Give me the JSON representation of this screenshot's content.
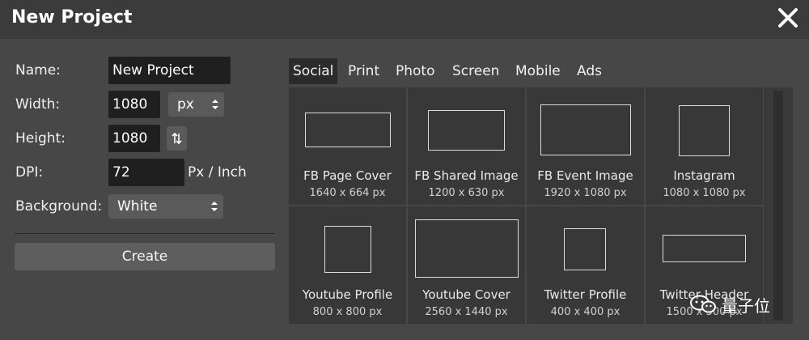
{
  "dialog": {
    "title": "New Project",
    "close_icon": "close-icon"
  },
  "form": {
    "name_label": "Name:",
    "name_value": "New Project",
    "width_label": "Width:",
    "width_value": "1080",
    "unit_value": "px",
    "height_label": "Height:",
    "height_value": "1080",
    "swap_icon": "swap-dimensions-icon",
    "dpi_label": "DPI:",
    "dpi_value": "72",
    "dpi_unit": "Px / Inch",
    "background_label": "Background:",
    "background_value": "White",
    "create_label": "Create"
  },
  "tabs": [
    {
      "label": "Social",
      "active": true
    },
    {
      "label": "Print",
      "active": false
    },
    {
      "label": "Photo",
      "active": false
    },
    {
      "label": "Screen",
      "active": false
    },
    {
      "label": "Mobile",
      "active": false
    },
    {
      "label": "Ads",
      "active": false
    }
  ],
  "templates": [
    {
      "name": "FB Page Cover",
      "size": "1640 x 664 px"
    },
    {
      "name": "FB Shared Image",
      "size": "1200 x 630 px"
    },
    {
      "name": "FB Event Image",
      "size": "1920 x 1080 px"
    },
    {
      "name": "Instagram",
      "size": "1080 x 1080 px"
    },
    {
      "name": "Youtube Profile",
      "size": "800 x 800 px"
    },
    {
      "name": "Youtube Cover",
      "size": "2560 x 1440 px"
    },
    {
      "name": "Twitter Profile",
      "size": "400 x 400 px"
    },
    {
      "name": "Twitter Header",
      "size": "1500 x 500 px"
    }
  ],
  "watermark": {
    "text": "量子位",
    "icon": "wechat-icon"
  },
  "colors": {
    "background": "#474747",
    "titlebar": "#3b3b3b",
    "field": "#1f1f1f",
    "tile": "#383838",
    "button": "#5e5e5e"
  }
}
